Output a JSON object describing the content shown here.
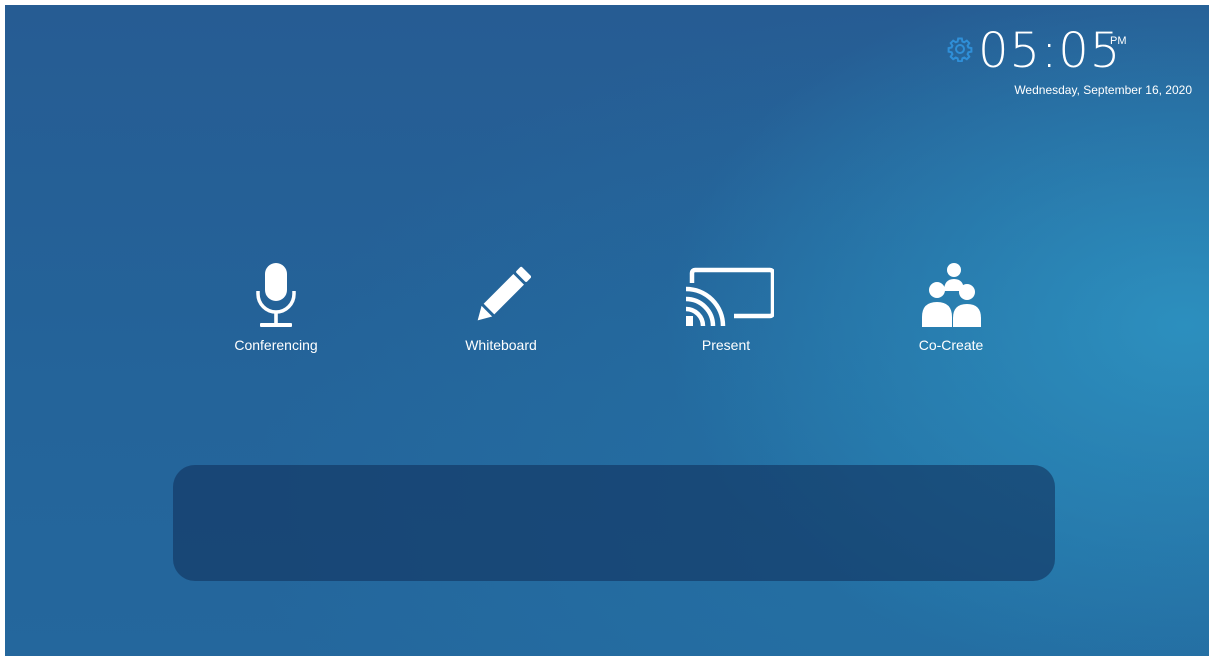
{
  "clock": {
    "time": "05:05",
    "ampm": "PM",
    "date": "Wednesday, September 16, 2020",
    "settings_icon": "gear-icon"
  },
  "apps": [
    {
      "label": "Conferencing",
      "icon": "microphone-icon"
    },
    {
      "label": "Whiteboard",
      "icon": "pencil-icon"
    },
    {
      "label": "Present",
      "icon": "cast-icon"
    },
    {
      "label": "Co-Create",
      "icon": "group-icon"
    }
  ],
  "colors": {
    "background": "#24649a",
    "accent_gear": "#2f8fd8",
    "text": "#ffffff",
    "panel": "#163f6c"
  }
}
